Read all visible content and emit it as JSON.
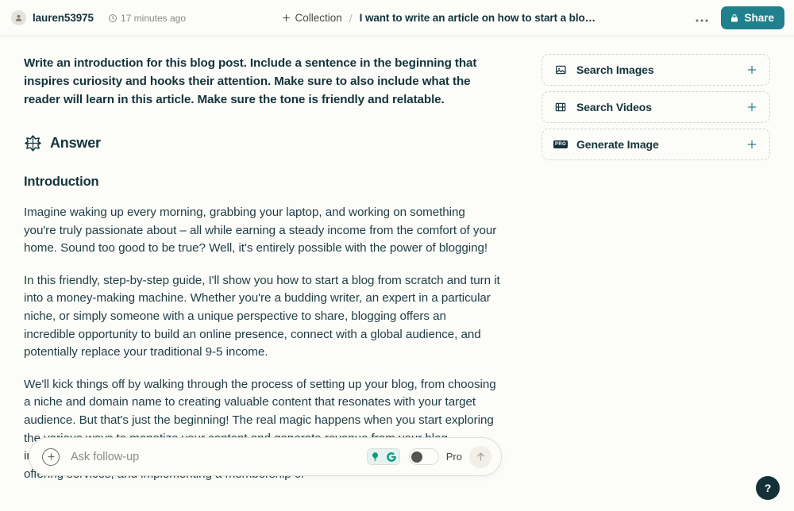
{
  "header": {
    "avatar_icon": "person-icon",
    "username": "lauren53975",
    "clock_icon": "clock-icon",
    "timestamp": "17 minutes ago",
    "collection_label": "Collection",
    "collection_plus_icon": "plus-icon",
    "separator": "/",
    "breadcrumb_title": "I want to write an article on how to start a blo…",
    "more_label": "•••",
    "more_icon": "ellipsis-icon",
    "share_label": "Share",
    "share_lock_icon": "lock-icon",
    "share_color": "#20808D"
  },
  "main": {
    "prompt": "Write an introduction for this blog post. Include a sentence in the beginning that inspires curiosity and hooks their attention. Make sure to also include what the reader will learn in this article. Make sure the tone is friendly and relatable.",
    "answer_label": "Answer",
    "answer_icon": "perplexity-logo-icon",
    "section_title": "Introduction",
    "paragraphs": [
      "Imagine waking up every morning, grabbing your laptop, and working on something you're truly passionate about – all while earning a steady income from the comfort of your home. Sound too good to be true? Well, it's entirely possible with the power of blogging!",
      "In this friendly, step-by-step guide, I'll show you how to start a blog from scratch and turn it into a money-making machine. Whether you're a budding writer, an expert in a particular niche, or simply someone with a unique perspective to share, blogging offers an incredible opportunity to build an online presence, connect with a global audience, and potentially replace your traditional 9-5 income.",
      "We'll kick things off by walking through the process of setting up your blog, from choosing a niche and domain name to creating valuable content that resonates with your target audience. But that's just the beginning! The real magic happens when you start exploring the various ways to monetize your content and generate revenue from your blog, including affiliate marketing, sponsored content, display advertising, digital product sales, offering services, and implementing a membership or"
    ]
  },
  "sidebar": {
    "cards": [
      {
        "label": "Search Images",
        "icon": "image-icon",
        "action_icon": "plus-icon",
        "pro": false
      },
      {
        "label": "Search Videos",
        "icon": "video-film-icon",
        "action_icon": "plus-icon",
        "pro": false
      },
      {
        "label": "Generate Image",
        "icon": "pro-badge-icon",
        "action_icon": "plus-icon",
        "pro": true,
        "pro_text": "PRO"
      }
    ]
  },
  "followup": {
    "add_icon": "plus-circle-icon",
    "placeholder": "Ask follow-up",
    "value": "",
    "chips": [
      {
        "icon": "lightbulb-icon",
        "active": true
      },
      {
        "icon": "focus-g-icon",
        "active": true
      }
    ],
    "toggle_icon": "toggle-switch-off",
    "toggle_on": false,
    "pro_label": "Pro",
    "submit_icon": "arrow-up-icon"
  },
  "help": {
    "label": "?",
    "icon": "question-mark-icon"
  }
}
